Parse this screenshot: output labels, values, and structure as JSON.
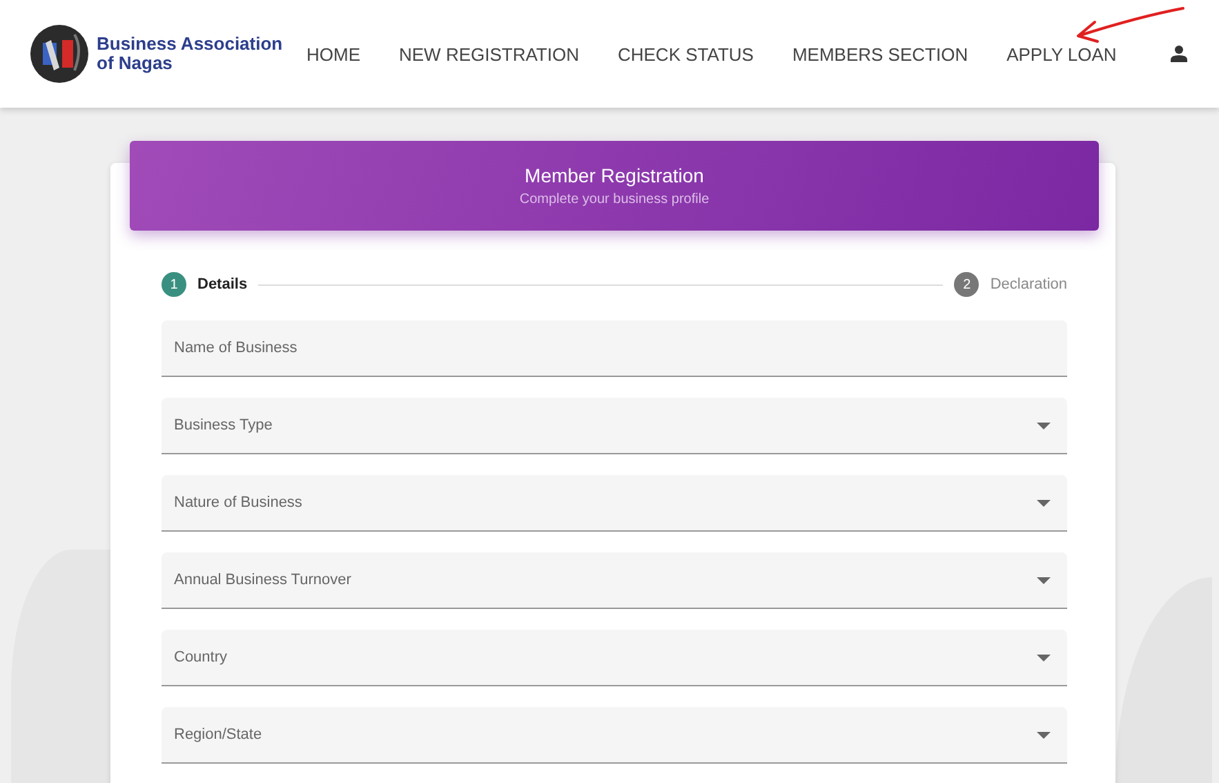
{
  "brand": {
    "name": "Business Association of Nagas"
  },
  "nav": [
    {
      "label": "HOME"
    },
    {
      "label": "NEW REGISTRATION"
    },
    {
      "label": "CHECK STATUS"
    },
    {
      "label": "MEMBERS SECTION"
    },
    {
      "label": "APPLY LOAN"
    }
  ],
  "card": {
    "title": "Member Registration",
    "subtitle": "Complete your business profile"
  },
  "steps": [
    {
      "number": "1",
      "label": "Details",
      "selected": true
    },
    {
      "number": "2",
      "label": "Declaration",
      "selected": false
    }
  ],
  "fields": [
    {
      "kind": "text",
      "placeholder": "Name of Business"
    },
    {
      "kind": "select",
      "placeholder": "Business Type"
    },
    {
      "kind": "select",
      "placeholder": "Nature of Business"
    },
    {
      "kind": "select",
      "placeholder": "Annual Business Turnover"
    },
    {
      "kind": "select",
      "placeholder": "Country"
    },
    {
      "kind": "select",
      "placeholder": "Region/State"
    }
  ]
}
